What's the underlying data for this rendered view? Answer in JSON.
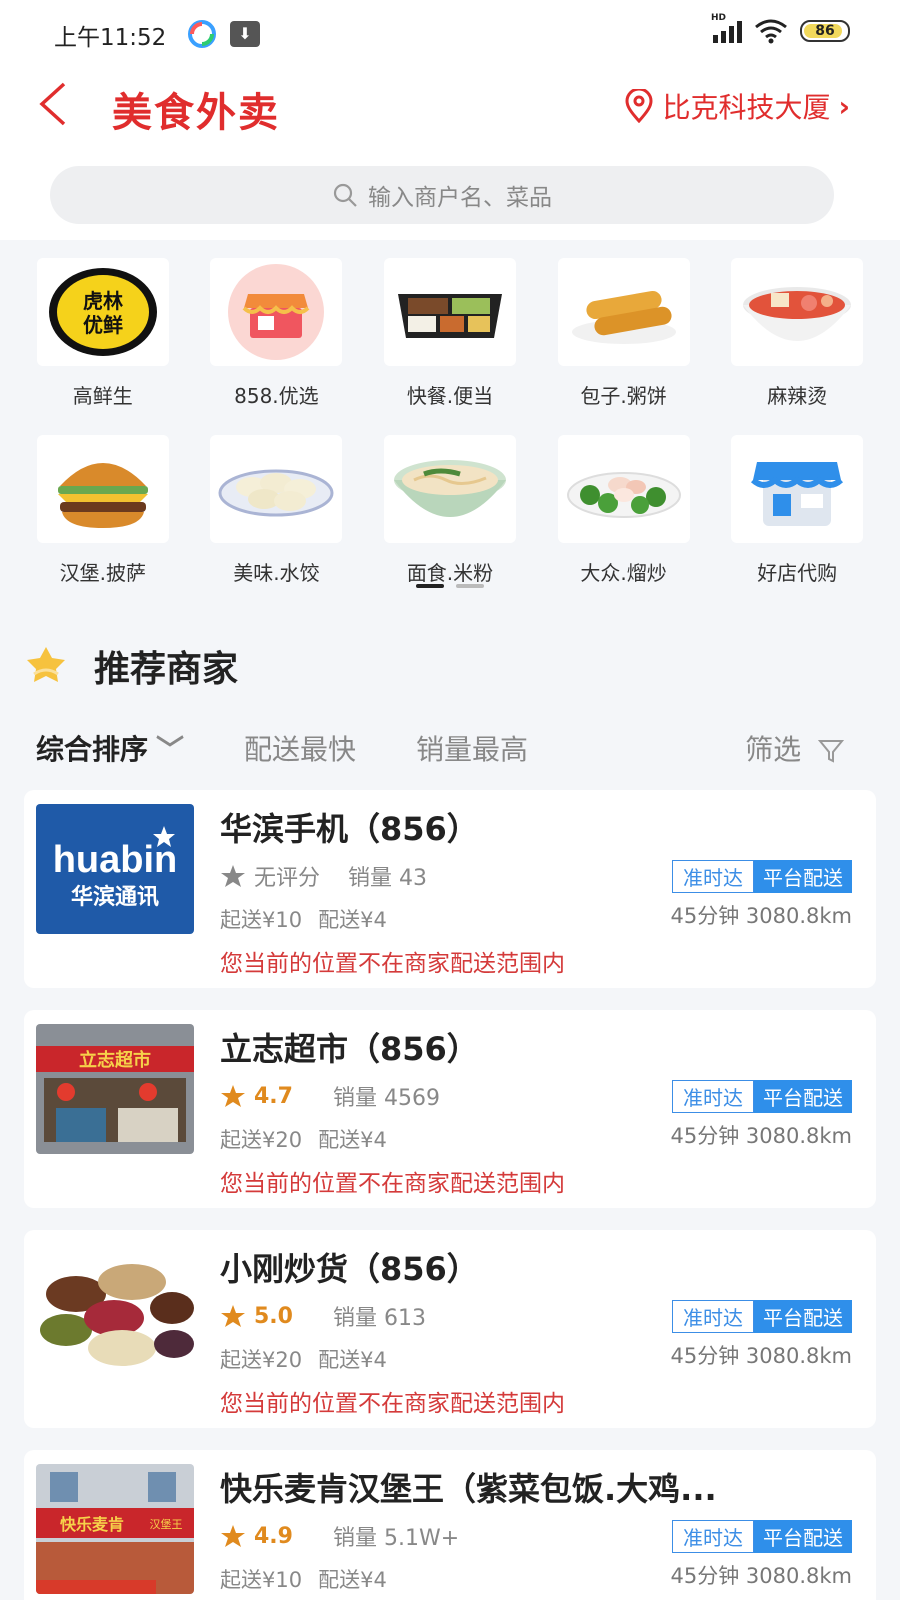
{
  "status": {
    "time": "上午11:52",
    "battery": "86",
    "network": "HD"
  },
  "nav": {
    "title": "美食外卖",
    "location": "比克科技大厦"
  },
  "search": {
    "placeholder": "输入商户名、菜品"
  },
  "categories": [
    {
      "label": "高鲜生",
      "logo_text": "虎林优鲜",
      "icon": "brand-logo"
    },
    {
      "label": "858.优选",
      "icon": "shop-icon"
    },
    {
      "label": "快餐.便当",
      "icon": "bento-icon"
    },
    {
      "label": "包子.粥饼",
      "icon": "fried-dough-icon"
    },
    {
      "label": "麻辣烫",
      "icon": "spicy-soup-icon"
    },
    {
      "label": "汉堡.披萨",
      "icon": "burger-icon"
    },
    {
      "label": "美味.水饺",
      "icon": "dumpling-icon"
    },
    {
      "label": "面食.米粉",
      "icon": "noodle-icon"
    },
    {
      "label": "大众.熘炒",
      "icon": "stir-fry-icon"
    },
    {
      "label": "好店代购",
      "icon": "store-icon"
    }
  ],
  "recommend": {
    "title": "推荐商家",
    "sort": {
      "default": "综合排序",
      "fastest": "配送最快",
      "top_sales": "销量最高",
      "filter": "筛选"
    }
  },
  "shops": [
    {
      "name": "华滨手机（856）",
      "rating": "无评分",
      "rated": false,
      "sales": "销量 43",
      "min_order": "起送¥10",
      "delivery_fee": "配送¥4",
      "tag1": "准时达",
      "tag2": "平台配送",
      "distance": "45分钟 3080.8km",
      "warning": "您当前的位置不在商家配送范围内",
      "logo_text": "huabin",
      "logo_sub": "华滨通讯"
    },
    {
      "name": "立志超市（856）",
      "rating": "4.7",
      "rated": true,
      "sales": "销量 4569",
      "min_order": "起送¥20",
      "delivery_fee": "配送¥4",
      "tag1": "准时达",
      "tag2": "平台配送",
      "distance": "45分钟 3080.8km",
      "warning": "您当前的位置不在商家配送范围内"
    },
    {
      "name": "小刚炒货（856）",
      "rating": "5.0",
      "rated": true,
      "sales": "销量 613",
      "min_order": "起送¥20",
      "delivery_fee": "配送¥4",
      "tag1": "准时达",
      "tag2": "平台配送",
      "distance": "45分钟 3080.8km",
      "warning": "您当前的位置不在商家配送范围内"
    },
    {
      "name": "快乐麦肯汉堡王（紫菜包饭.大鸡...",
      "rating": "4.9",
      "rated": true,
      "sales": "销量 5.1W+",
      "min_order": "起送¥10",
      "delivery_fee": "配送¥4",
      "tag1": "准时达",
      "tag2": "平台配送",
      "distance": "45分钟 3080.8km",
      "warning": ""
    }
  ],
  "colors": {
    "brand_red": "#e02d2d",
    "tag_blue": "#2f8fea",
    "rating_orange": "#e08a1e"
  }
}
